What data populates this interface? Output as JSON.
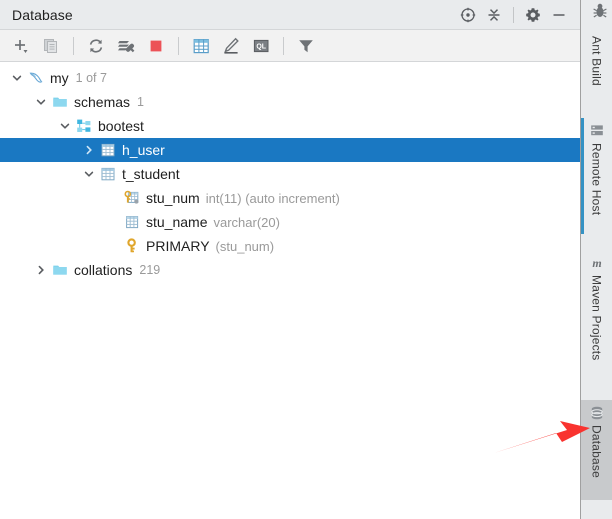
{
  "window": {
    "title": "Database",
    "title_actions": [
      {
        "name": "locate-icon",
        "label": "Scroll from Source"
      },
      {
        "name": "collapse-all-icon",
        "label": "Collapse All"
      },
      {
        "name": "gear-icon",
        "label": "Settings"
      },
      {
        "name": "minimize-icon",
        "label": "Hide"
      }
    ],
    "corner_icon": "bug-icon"
  },
  "toolbar": {
    "items": [
      {
        "name": "add-icon",
        "label": "New"
      },
      {
        "name": "copy-icon",
        "label": "Duplicate"
      },
      {
        "name": "refresh-icon",
        "label": "Synchronize"
      },
      {
        "name": "run-script-icon",
        "label": "Run Script"
      },
      {
        "name": "stop-icon",
        "label": "Stop"
      },
      {
        "name": "table-editor-icon",
        "label": "Table Editor"
      },
      {
        "name": "modify-icon",
        "label": "Modify"
      },
      {
        "name": "query-console-icon",
        "label": "Query Console"
      },
      {
        "name": "filter-icon",
        "label": "Filter"
      }
    ]
  },
  "tree": {
    "nodes": [
      {
        "name": "tree-node-my",
        "label": "my",
        "sublabel": "1 of 7",
        "typelabel": "",
        "icon": "mysql-dolphin-icon",
        "indent": 0,
        "twisty": "down",
        "selected": false
      },
      {
        "name": "tree-node-schemas",
        "label": "schemas",
        "sublabel": "1",
        "typelabel": "",
        "icon": "folder-icon",
        "indent": 1,
        "twisty": "down",
        "selected": false
      },
      {
        "name": "tree-node-bootest",
        "label": "bootest",
        "sublabel": "",
        "typelabel": "",
        "icon": "schema-icon",
        "indent": 2,
        "twisty": "down",
        "selected": false
      },
      {
        "name": "tree-node-h-user",
        "label": "h_user",
        "sublabel": "",
        "typelabel": "",
        "icon": "table-icon",
        "indent": 3,
        "twisty": "right",
        "selected": true
      },
      {
        "name": "tree-node-t-student",
        "label": "t_student",
        "sublabel": "",
        "typelabel": "",
        "icon": "table-icon",
        "indent": 3,
        "twisty": "down",
        "selected": false
      },
      {
        "name": "tree-node-stu-num",
        "label": "stu_num",
        "sublabel": "",
        "typelabel": "int(11) (auto increment)",
        "icon": "primary-key-column-icon",
        "indent": 4,
        "twisty": "none",
        "selected": false
      },
      {
        "name": "tree-node-stu-name",
        "label": "stu_name",
        "sublabel": "",
        "typelabel": "varchar(20)",
        "icon": "column-icon",
        "indent": 4,
        "twisty": "none",
        "selected": false
      },
      {
        "name": "tree-node-primary-key",
        "label": "PRIMARY",
        "sublabel": "",
        "typelabel": "(stu_num)",
        "icon": "key-icon",
        "indent": 4,
        "twisty": "none",
        "selected": false
      },
      {
        "name": "tree-node-collations",
        "label": "collations",
        "sublabel": "219",
        "typelabel": "",
        "icon": "folder-icon",
        "indent": 1,
        "twisty": "right",
        "selected": false
      }
    ]
  },
  "sidebar": {
    "tabs": [
      {
        "name": "sidebar-tab-ant-build",
        "label": "Ant Build",
        "icon": "",
        "active": false,
        "indicator": false
      },
      {
        "name": "sidebar-tab-remote-host",
        "label": "Remote Host",
        "icon": "remote-host-icon",
        "active": false,
        "indicator": true
      },
      {
        "name": "sidebar-tab-maven-projects",
        "label": "Maven Projects",
        "icon": "maven-m-icon",
        "active": false,
        "indicator": false
      },
      {
        "name": "sidebar-tab-database",
        "label": "Database",
        "icon": "database-icon",
        "active": true,
        "indicator": false
      }
    ]
  },
  "annotation": {
    "name": "red-arrow",
    "color": "#f9332f",
    "points_to": "Database"
  },
  "colors": {
    "selection_blue": "#1a78c2",
    "accent_blue": "#3592c4",
    "header_bg": "#e9ebed",
    "toolbar_bg": "#f2f2f2",
    "muted_text": "#9a9a9a",
    "arrow_red": "#f9332f"
  }
}
